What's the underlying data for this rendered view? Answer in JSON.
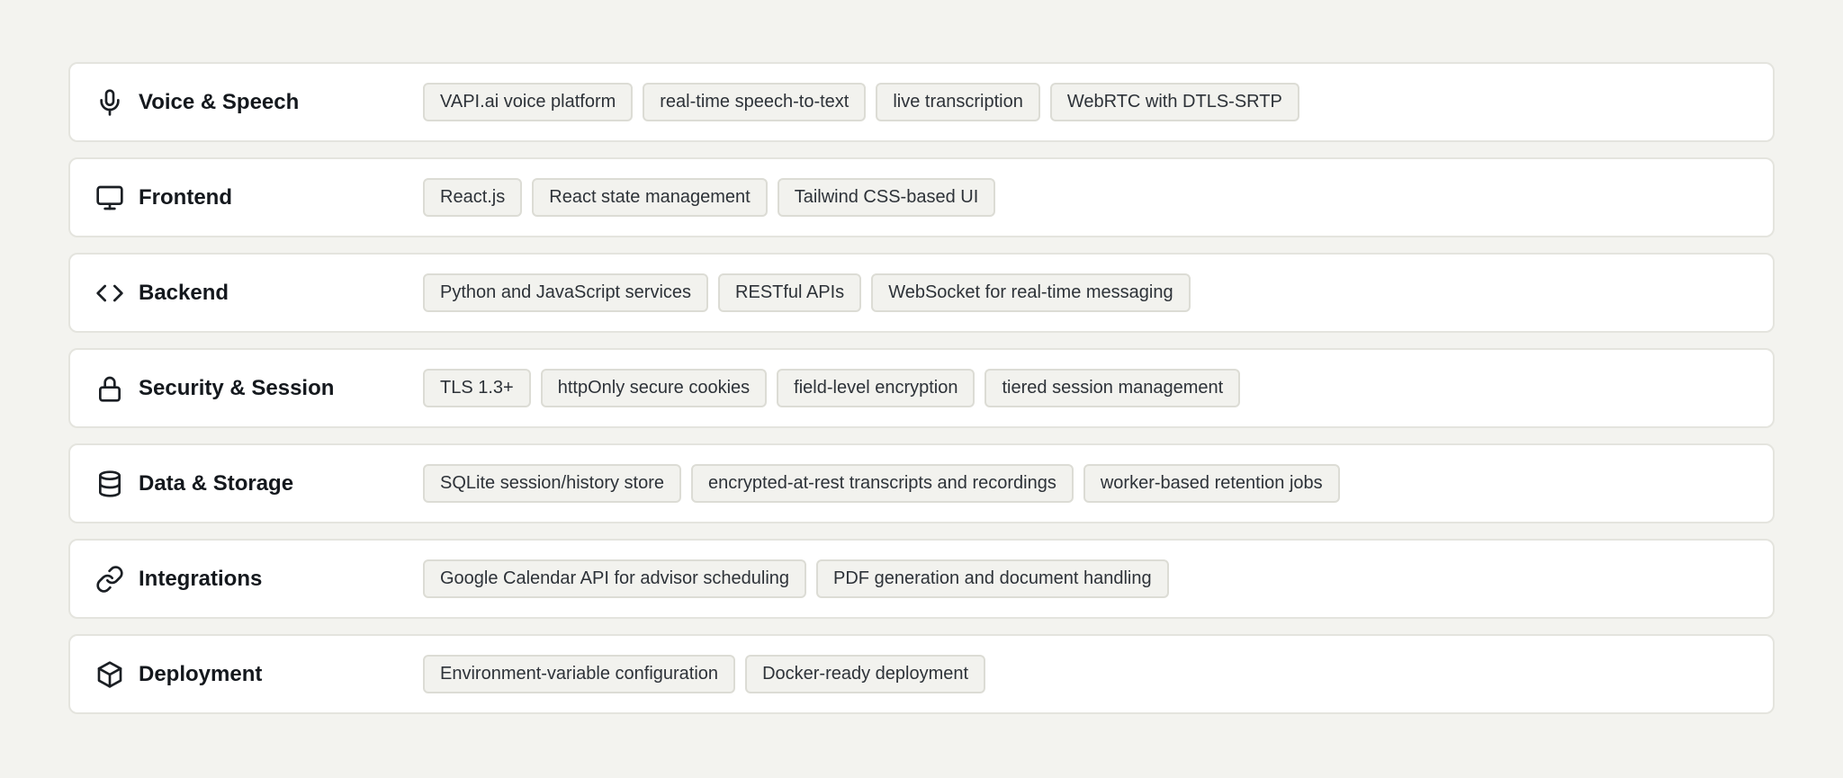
{
  "rows": [
    {
      "title": "Voice & Speech",
      "icon": "microphone-icon",
      "tags": [
        "VAPI.ai voice platform",
        "real-time speech-to-text",
        "live transcription",
        "WebRTC with DTLS-SRTP"
      ]
    },
    {
      "title": "Frontend",
      "icon": "monitor-icon",
      "tags": [
        "React.js",
        "React state management",
        "Tailwind CSS-based UI"
      ]
    },
    {
      "title": "Backend",
      "icon": "code-icon",
      "tags": [
        "Python and JavaScript services",
        "RESTful APIs",
        "WebSocket for real-time messaging"
      ]
    },
    {
      "title": "Security & Session",
      "icon": "lock-icon",
      "tags": [
        "TLS 1.3+",
        "httpOnly secure cookies",
        "field-level encryption",
        "tiered session management"
      ]
    },
    {
      "title": "Data & Storage",
      "icon": "database-icon",
      "tags": [
        "SQLite session/history store",
        "encrypted-at-rest transcripts and recordings",
        "worker-based retention jobs"
      ]
    },
    {
      "title": "Integrations",
      "icon": "link-icon",
      "tags": [
        "Google Calendar API for advisor scheduling",
        "PDF generation and document handling"
      ]
    },
    {
      "title": "Deployment",
      "icon": "package-icon",
      "tags": [
        "Environment-variable configuration",
        "Docker-ready deployment"
      ]
    }
  ],
  "colors": {
    "background": "#f3f3ef",
    "card": "#ffffff",
    "card_border": "#e4e4de",
    "tag_background": "#f2f2ee",
    "tag_border": "#dcdcd5",
    "text": "#1b1f24"
  }
}
